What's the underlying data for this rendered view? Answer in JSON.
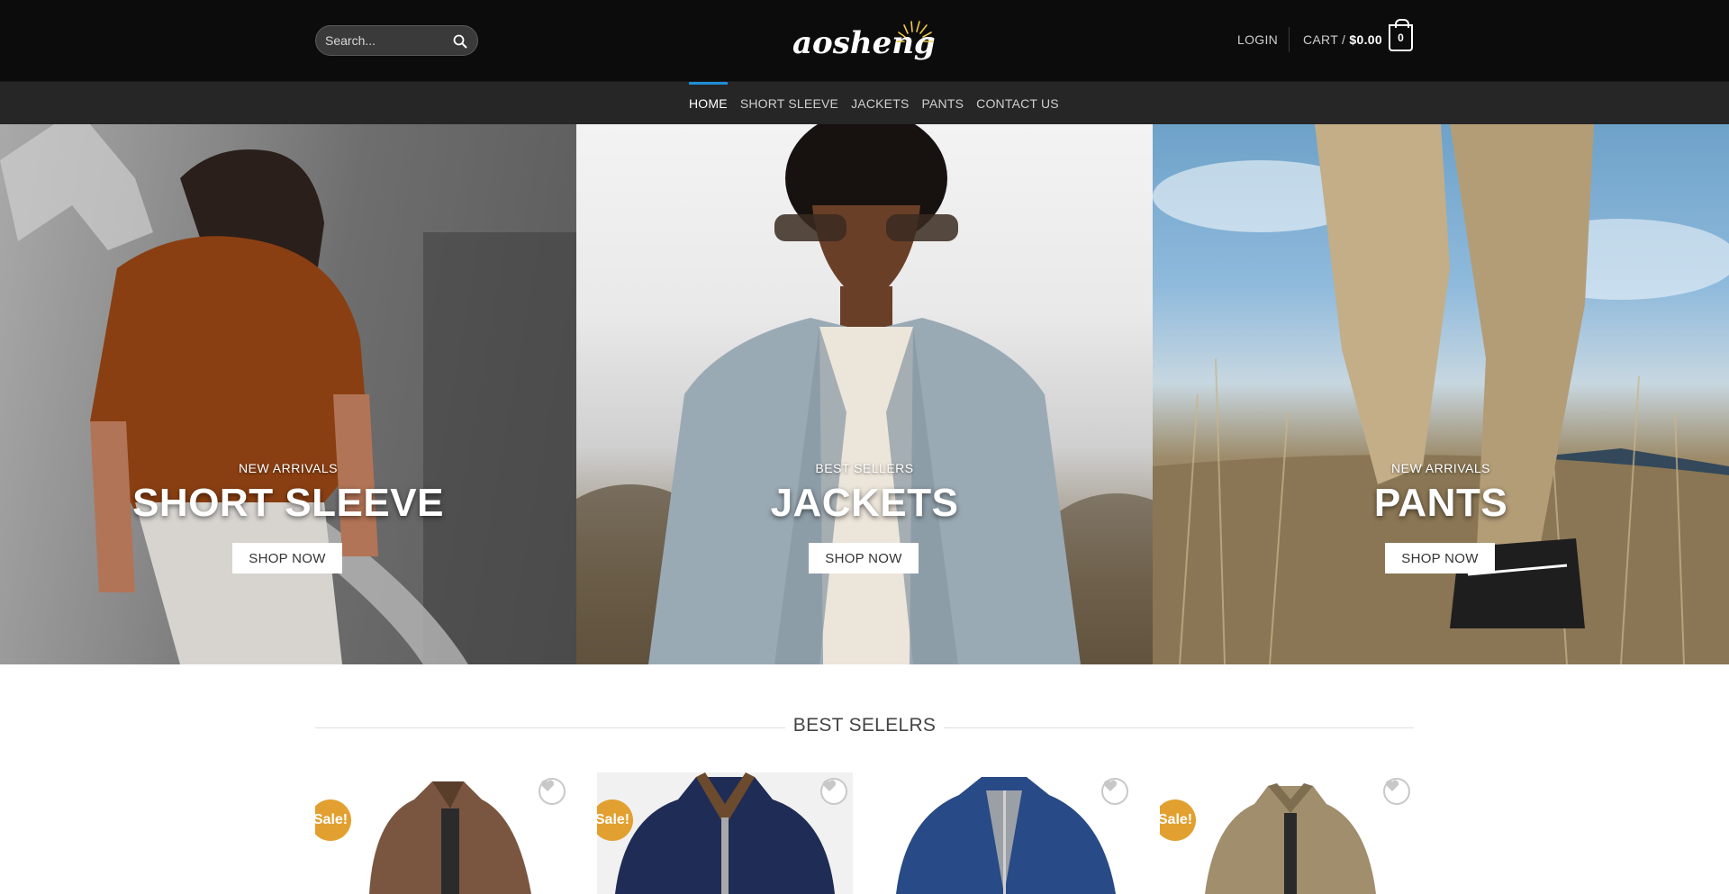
{
  "header": {
    "search_placeholder": "Search...",
    "logo_text": "aosheng",
    "login_label": "LOGIN",
    "cart_prefix": "CART /",
    "cart_total": "$0.00",
    "cart_count": "0"
  },
  "nav": {
    "items": [
      {
        "label": "HOME",
        "active": true
      },
      {
        "label": "SHORT SLEEVE"
      },
      {
        "label": "JACKETS"
      },
      {
        "label": "PANTS"
      },
      {
        "label": "CONTACT US"
      }
    ]
  },
  "banners": [
    {
      "subtitle": "NEW ARRIVALS",
      "title": "SHORT SLEEVE",
      "button": "SHOP NOW"
    },
    {
      "subtitle": "BEST SELLERS",
      "title": "JACKETS",
      "button": "SHOP NOW"
    },
    {
      "subtitle": "NEW ARRIVALS",
      "title": "PANTS",
      "button": "SHOP NOW"
    }
  ],
  "best_sellers": {
    "title": "BEST SELELRS",
    "products": [
      {
        "badge": "Sale!"
      },
      {
        "badge": "Sale!"
      },
      {
        "badge": ""
      },
      {
        "badge": "Sale!"
      }
    ]
  },
  "colors": {
    "accent": "#1f8fd8",
    "sale_badge": "#e2a030",
    "topbar": "#0c0c0c",
    "navbar": "#262626"
  },
  "icons": [
    "search-icon",
    "cart-icon",
    "heart-icon",
    "logo-sun-icon"
  ]
}
